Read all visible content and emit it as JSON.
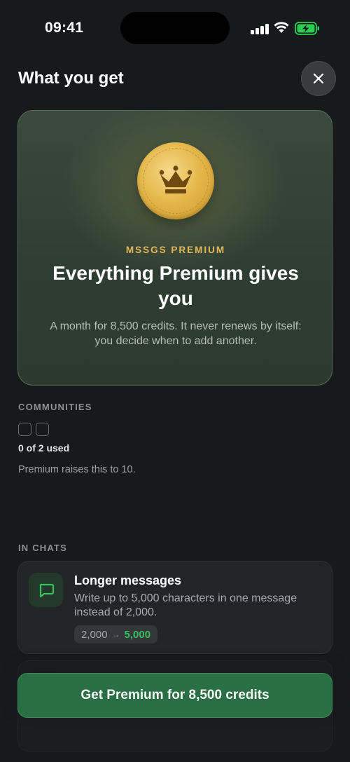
{
  "status_bar": {
    "time": "09:41"
  },
  "header": {
    "title": "What you get",
    "close_label": "×"
  },
  "hero": {
    "eyebrow": "MSSGS PREMIUM",
    "title": "Everything Premium gives you",
    "description": "A month for 8,500 credits. It never renews by itself: you decide when to add another.",
    "icon": "crown-coin-icon"
  },
  "communities": {
    "label": "COMMUNITIES",
    "slots_total": 2,
    "used_text": "0 of 2 used",
    "note": "Premium raises this to 10."
  },
  "in_chats": {
    "label": "IN CHATS",
    "features": [
      {
        "icon": "message-icon",
        "title": "Longer messages",
        "description": "Write up to 5,000 characters in one message instead of 2,000.",
        "old_value": "2,000",
        "new_value": "5,000"
      }
    ]
  },
  "cta": {
    "label": "Get Premium for 8,500 credits"
  },
  "colors": {
    "background": "#18191b",
    "accent_green": "#37c15e",
    "cta_green": "#2a6e45",
    "gold": "#e3b85c"
  }
}
